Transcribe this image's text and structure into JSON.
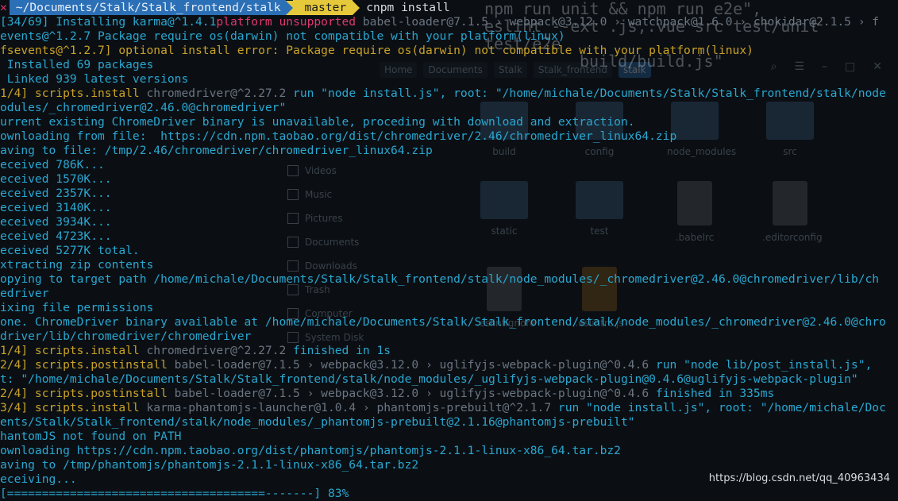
{
  "prompt": {
    "status_icon": "✕",
    "path": "~/Documents/Stalk/Stalk_frontend/stalk",
    "git_branch_icon": "",
    "git_branch": "master",
    "command": "cnpm install"
  },
  "ghost_editor": [
    "npm run unit && npm run e2e\",",
    "eslint --ext .js,.vue src test/unit test/e2e",
    "build/build.js\""
  ],
  "file_manager": {
    "breadcrumbs": [
      "Home",
      "Documents",
      "Stalk",
      "Stalk_frontend",
      "stalk"
    ],
    "places": [
      "Videos",
      "Music",
      "Pictures",
      "Documents",
      "Downloads",
      "Trash",
      "Computer",
      "System Disk"
    ],
    "items": [
      {
        "name": "build",
        "kind": "folder"
      },
      {
        "name": "config",
        "kind": "folder"
      },
      {
        "name": "node_modules",
        "kind": "folder"
      },
      {
        "name": "src",
        "kind": "folder"
      },
      {
        "name": "static",
        "kind": "folder"
      },
      {
        "name": "test",
        "kind": "folder"
      },
      {
        "name": ".babelrc",
        "kind": "file"
      },
      {
        "name": ".editorconfig",
        "kind": "file"
      },
      {
        "name": ".eslintignore",
        "kind": "file"
      },
      {
        "name": ".eslintrc.js",
        "kind": "js"
      }
    ]
  },
  "lines": [
    {
      "segs": [
        [
          "[34/69] Installing karma@^1.4.1",
          "c-cyan"
        ],
        [
          "platform unsupported",
          "c-red"
        ],
        [
          " babel-loader@7.1.5 › webpack@3.12.0 › watchpack@1.6.0 › chokidar@2.1.5 › f",
          "c-gray"
        ]
      ]
    },
    {
      "segs": [
        [
          "events@^1.2.7 Package require os(darwin) not compatible with your platform(linux)",
          "c-cyan"
        ]
      ]
    },
    {
      "segs": [
        [
          "fsevents@^1.2.7] optional install error: Package require os(darwin) not compatible with your platform(linux)",
          "c-yellow"
        ]
      ]
    },
    {
      "segs": [
        [
          " Installed 69 packages",
          "c-cyan"
        ]
      ]
    },
    {
      "segs": [
        [
          " Linked 939 latest versions",
          "c-cyan"
        ]
      ]
    },
    {
      "segs": [
        [
          "1/4] scripts.install",
          "c-yellow"
        ],
        [
          " chromedriver@^2.27.2",
          "c-gray"
        ],
        [
          " run \"node install.js\", root: \"/home/michale/Documents/Stalk/Stalk_frontend/stalk/node",
          "c-cyan"
        ]
      ]
    },
    {
      "segs": [
        [
          "odules/_chromedriver@2.46.0@chromedriver\"",
          "c-cyan"
        ]
      ]
    },
    {
      "segs": [
        [
          "urrent existing ChromeDriver binary is unavailable, proceding with download and extraction.",
          "c-cyan"
        ]
      ]
    },
    {
      "segs": [
        [
          "ownloading from file:  https://cdn.npm.taobao.org/dist/chromedriver/2.46/chromedriver_linux64.zip",
          "c-cyan"
        ]
      ]
    },
    {
      "segs": [
        [
          "aving to file: /tmp/2.46/chromedriver/chromedriver_linux64.zip",
          "c-cyan"
        ]
      ]
    },
    {
      "segs": [
        [
          "eceived 786K...",
          "c-cyan"
        ]
      ]
    },
    {
      "segs": [
        [
          "eceived 1570K...",
          "c-cyan"
        ]
      ]
    },
    {
      "segs": [
        [
          "eceived 2357K...",
          "c-cyan"
        ]
      ]
    },
    {
      "segs": [
        [
          "eceived 3140K...",
          "c-cyan"
        ]
      ]
    },
    {
      "segs": [
        [
          "eceived 3934K...",
          "c-cyan"
        ]
      ]
    },
    {
      "segs": [
        [
          "eceived 4723K...",
          "c-cyan"
        ]
      ]
    },
    {
      "segs": [
        [
          "eceived 5277K total.",
          "c-cyan"
        ]
      ]
    },
    {
      "segs": [
        [
          "xtracting zip contents",
          "c-cyan"
        ]
      ]
    },
    {
      "segs": [
        [
          "opying to target path /home/michale/Documents/Stalk/Stalk_frontend/stalk/node_modules/_chromedriver@2.46.0@chromedriver/lib/ch",
          "c-cyan"
        ]
      ]
    },
    {
      "segs": [
        [
          "edriver",
          "c-cyan"
        ]
      ]
    },
    {
      "segs": [
        [
          "ixing file permissions",
          "c-cyan"
        ]
      ]
    },
    {
      "segs": [
        [
          "one. ChromeDriver binary available at /home/michale/Documents/Stalk/Stalk_frontend/stalk/node_modules/_chromedriver@2.46.0@chro",
          "c-cyan"
        ]
      ]
    },
    {
      "segs": [
        [
          "driver/lib/chromedriver/chromedriver",
          "c-cyan"
        ]
      ]
    },
    {
      "segs": [
        [
          "1/4] scripts.install",
          "c-yellow"
        ],
        [
          " chromedriver@^2.27.2",
          "c-gray"
        ],
        [
          " finished in 1s",
          "c-cyan"
        ]
      ]
    },
    {
      "segs": [
        [
          "2/4] scripts.postinstall",
          "c-yellow"
        ],
        [
          " babel-loader@7.1.5 › webpack@3.12.0 › uglifyjs-webpack-plugin@^0.4.6",
          "c-gray"
        ],
        [
          " run \"node lib/post_install.js\",",
          "c-cyan"
        ]
      ]
    },
    {
      "segs": [
        [
          "t: \"/home/michale/Documents/Stalk/Stalk_frontend/stalk/node_modules/_uglifyjs-webpack-plugin@0.4.6@uglifyjs-webpack-plugin\"",
          "c-cyan"
        ]
      ]
    },
    {
      "segs": [
        [
          "2/4] scripts.postinstall",
          "c-yellow"
        ],
        [
          " babel-loader@7.1.5 › webpack@3.12.0 › uglifyjs-webpack-plugin@^0.4.6",
          "c-gray"
        ],
        [
          " finished in 335ms",
          "c-cyan"
        ]
      ]
    },
    {
      "segs": [
        [
          "3/4] scripts.install",
          "c-yellow"
        ],
        [
          " karma-phantomjs-launcher@1.0.4 › phantomjs-prebuilt@^2.1.7",
          "c-gray"
        ],
        [
          " run \"node install.js\", root: \"/home/michale/Doc",
          "c-cyan"
        ]
      ]
    },
    {
      "segs": [
        [
          "ents/Stalk/Stalk_frontend/stalk/node_modules/_phantomjs-prebuilt@2.1.16@phantomjs-prebuilt\"",
          "c-cyan"
        ]
      ]
    },
    {
      "segs": [
        [
          "hantomJS not found on PATH",
          "c-cyan"
        ]
      ]
    },
    {
      "segs": [
        [
          "ownloading https://cdn.npm.taobao.org/dist/phantomjs/phantomjs-2.1.1-linux-x86_64.tar.bz2",
          "c-cyan"
        ]
      ]
    },
    {
      "segs": [
        [
          "aving to /tmp/phantomjs/phantomjs-2.1.1-linux-x86_64.tar.bz2",
          "c-cyan"
        ]
      ]
    },
    {
      "segs": [
        [
          "eceiving...",
          "c-cyan"
        ]
      ]
    },
    {
      "segs": [
        [
          "[=====================================-------] 83%",
          "c-cyan"
        ]
      ]
    }
  ],
  "watermark": "https://blog.csdn.net/qq_40963434"
}
